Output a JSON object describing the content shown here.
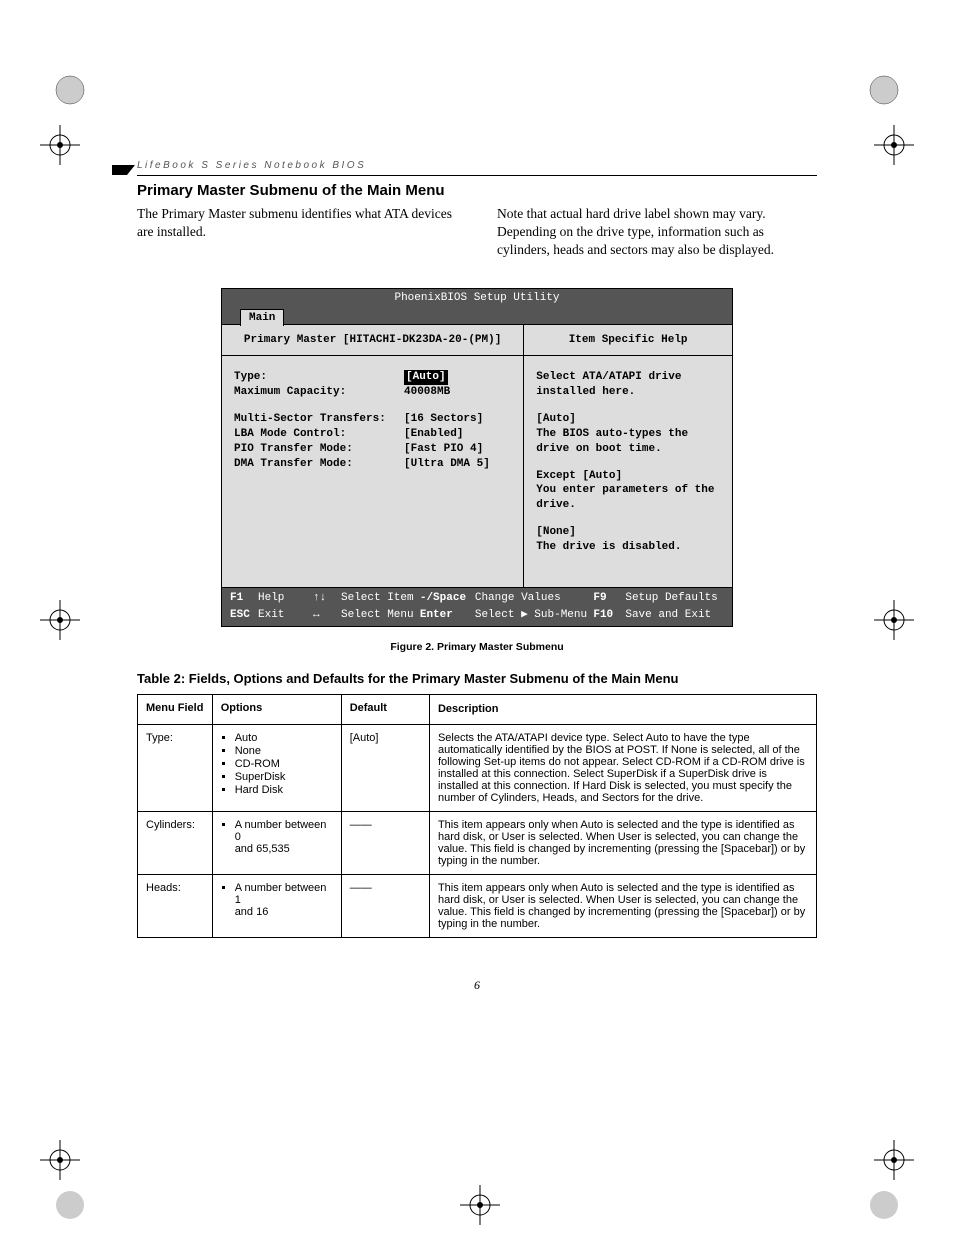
{
  "running_head": "LifeBook S Series Notebook BIOS",
  "section_title": "Primary Master Submenu of the Main Menu",
  "intro_left": "The Primary Master submenu identifies what ATA devices are installed.",
  "intro_right": "Note that actual hard drive label shown may vary. Depending on the drive type, information such as cylinders, heads and sectors may also be displayed.",
  "bios": {
    "title": "PhoenixBIOS Setup Utility",
    "tab": "Main",
    "left_subtitle": "Primary Master [HITACHI-DK23DA-20-(PM)]",
    "right_subtitle": "Item Specific Help",
    "fields": {
      "type_label": "Type:",
      "type_value": "[Auto]",
      "maxcap_label": "Maximum Capacity:",
      "maxcap_value": "40008MB",
      "mst_label": "Multi-Sector Transfers:",
      "mst_value": "[16 Sectors]",
      "lba_label": "LBA Mode Control:",
      "lba_value": "[Enabled]",
      "pio_label": "PIO Transfer Mode:",
      "pio_value": "[Fast PIO 4]",
      "dma_label": "DMA Transfer Mode:",
      "dma_value": "[Ultra DMA 5]"
    },
    "help": {
      "p1": "Select ATA/ATAPI drive installed here.",
      "p2a": "[Auto]",
      "p2b": "The BIOS auto-types the drive on boot time.",
      "p3a": "Except [Auto]",
      "p3b": "You enter parameters of the drive.",
      "p4a": "[None]",
      "p4b": "The drive is disabled."
    },
    "footer": {
      "f1": "F1",
      "help": "Help",
      "arrows_ud": "↑↓",
      "select_item": "Select Item",
      "minus_space": "-/Space",
      "change_values": "Change Values",
      "f9": "F9",
      "setup_defaults": "Setup Defaults",
      "esc": "ESC",
      "exit": "Exit",
      "arrows_lr": "↔",
      "select_menu": "Select Menu",
      "enter": "Enter",
      "select_sub": "Select ▶ Sub-Menu",
      "f10": "F10",
      "save_exit": "Save and Exit"
    }
  },
  "figure_caption": "Figure 2.  Primary Master Submenu",
  "table_title": "Table 2: Fields, Options and Defaults for the Primary Master Submenu of the Main Menu",
  "table": {
    "headers": {
      "field": "Menu Field",
      "options": "Options",
      "default": "Default",
      "desc": "Description"
    },
    "rows": [
      {
        "field": "Type:",
        "options": [
          "Auto",
          "None",
          "CD-ROM",
          "SuperDisk",
          "Hard Disk"
        ],
        "default": "[Auto]",
        "desc": "Selects the ATA/ATAPI device type. Select Auto to have the type automatically identified by the BIOS at POST. If None is selected, all of the following Set-up items do not appear. Select CD-ROM if a CD-ROM drive is installed at this connection. Select SuperDisk if a SuperDisk drive is installed at this connection. If Hard Disk is selected, you must specify the number of Cylinders, Heads, and Sectors for the drive."
      },
      {
        "field": "Cylinders:",
        "options": [
          "A number between 0 and 65,535"
        ],
        "default": "——",
        "desc": "This item appears only when Auto is selected and the type is identified as hard disk, or User is selected. When User is selected, you can change the value. This field is changed by incrementing (pressing the [Spacebar]) or by typing in the number."
      },
      {
        "field": "Heads:",
        "options": [
          "A number between 1 and 16"
        ],
        "default": "——",
        "desc": "This item appears only when Auto is selected and the type is identified as hard disk, or User is selected. When User is selected, you can change the value. This field is changed by incrementing (pressing the [Spacebar]) or by typing in the number."
      }
    ]
  },
  "page_number": "6"
}
